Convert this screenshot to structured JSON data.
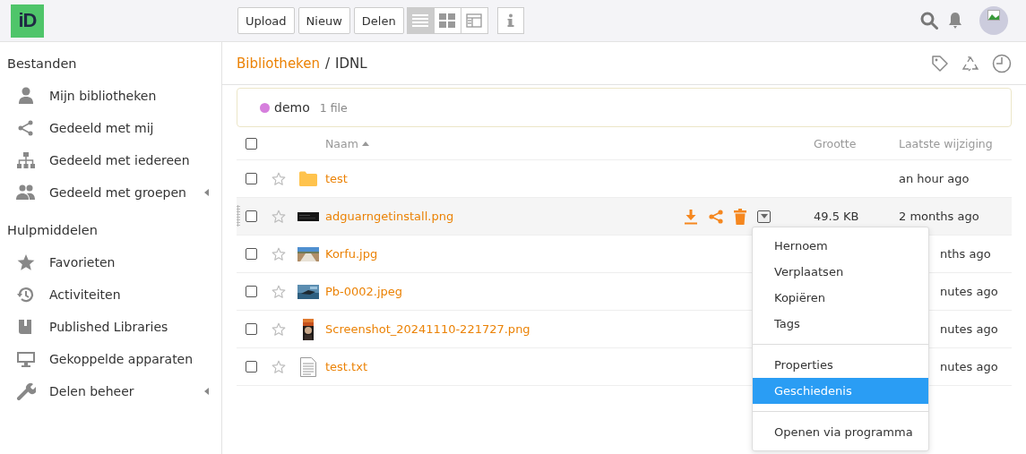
{
  "logo": {
    "text": "iD"
  },
  "toolbar": {
    "buttons": [
      "Upload",
      "Nieuw",
      "Delen"
    ],
    "view_modes": [
      {
        "kind": "list",
        "selected": true
      },
      {
        "kind": "grid",
        "selected": false
      },
      {
        "kind": "columns",
        "selected": false
      }
    ]
  },
  "sidebar": [
    {
      "heading": "Bestanden",
      "items": [
        {
          "label": "Mijn bibliotheken"
        },
        {
          "label": "Gedeeld met mij"
        },
        {
          "label": "Gedeeld met iedereen"
        },
        {
          "label": "Gedeeld met groepen",
          "expanded": false
        }
      ]
    },
    {
      "heading": "Hulpmiddelen",
      "items": [
        {
          "label": "Favorieten"
        },
        {
          "label": "Activiteiten"
        },
        {
          "label": "Published Libraries"
        },
        {
          "label": "Gekoppelde apparaten"
        },
        {
          "label": "Delen beheer",
          "expanded": false
        }
      ]
    }
  ],
  "breadcrumb": {
    "parts": [
      "Bibliotheken",
      "IDNL"
    ],
    "separator": "/"
  },
  "tag_bar": {
    "tag": "demo",
    "color": "#d67fdd",
    "count": "1 file"
  },
  "columns": {
    "name": "Naam",
    "size": "Grootte",
    "modified": "Laatste wijziging",
    "all_checked": false
  },
  "rows": [
    {
      "name": "test",
      "kind": "folder",
      "size": "",
      "modified": "an hour ago",
      "hovered": false,
      "checked": false,
      "starred": false
    },
    {
      "name": "adguarngetinstall.png",
      "size": "49.5 KB",
      "modified": "2 months ago",
      "hovered": true,
      "menu_open": true,
      "checked": false,
      "starred": false
    },
    {
      "name": "Korfu.jpg",
      "modified": "nths ago",
      "hovered": false,
      "checked": false,
      "starred": false
    },
    {
      "name": "Pb-0002.jpeg",
      "modified": "nutes ago",
      "hovered": false,
      "checked": false,
      "starred": false
    },
    {
      "name": "Screenshot_20241110-221727.png",
      "modified": "nutes ago",
      "hovered": false,
      "checked": false,
      "starred": false
    },
    {
      "name": "test.txt",
      "kind": "text",
      "modified": "nutes ago",
      "hovered": false,
      "checked": false,
      "starred": false
    }
  ],
  "menu": [
    [
      {
        "label": "Hernoem",
        "selected": false
      },
      {
        "label": "Verplaatsen",
        "selected": false
      },
      {
        "label": "Kopiëren",
        "selected": false
      },
      {
        "label": "Tags",
        "selected": false
      }
    ],
    [
      {
        "label": "Properties",
        "selected": false
      },
      {
        "label": "Geschiedenis",
        "selected": true
      }
    ],
    [
      {
        "label": "Openen via programma",
        "selected": false
      }
    ]
  ]
}
